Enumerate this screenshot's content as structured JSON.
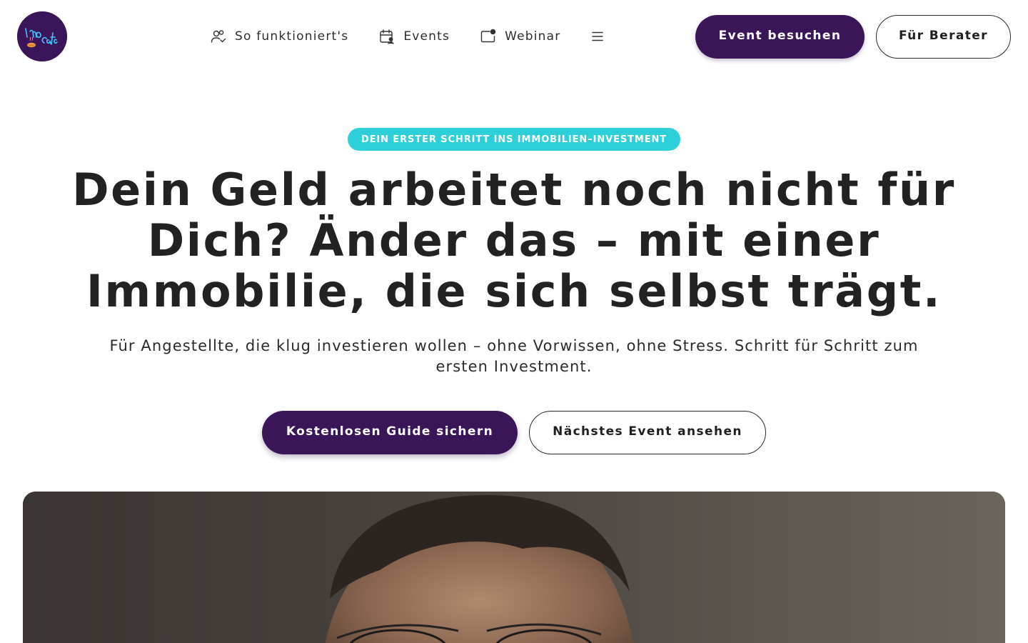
{
  "header": {
    "logo_text": "Immo café",
    "nav": [
      {
        "label": "So funktioniert's",
        "icon": "users-icon"
      },
      {
        "label": "Events",
        "icon": "calendar-user-icon"
      },
      {
        "label": "Webinar",
        "icon": "video-screen-icon"
      }
    ],
    "menu_icon": "hamburger-menu-icon",
    "primary_button": "Event besuchen",
    "secondary_button": "Für Berater"
  },
  "hero": {
    "badge": "DEIN ERSTER SCHRITT INS IMMOBILIEN–INVESTMENT",
    "headline": "Dein Geld arbeitet noch nicht für Dich? Änder das – mit einer Immobilie, die sich selbst trägt.",
    "subline": "Für Angestellte, die klug investieren wollen – ohne Vorwissen, ohne Stress. Schritt für Schritt zum ersten Investment.",
    "cta_primary": "Kostenlosen Guide sichern",
    "cta_secondary": "Nächstes Event ansehen"
  },
  "colors": {
    "brand_purple": "#3a1558",
    "badge_cyan": "#2dcfd9",
    "text_dark": "#222222"
  }
}
